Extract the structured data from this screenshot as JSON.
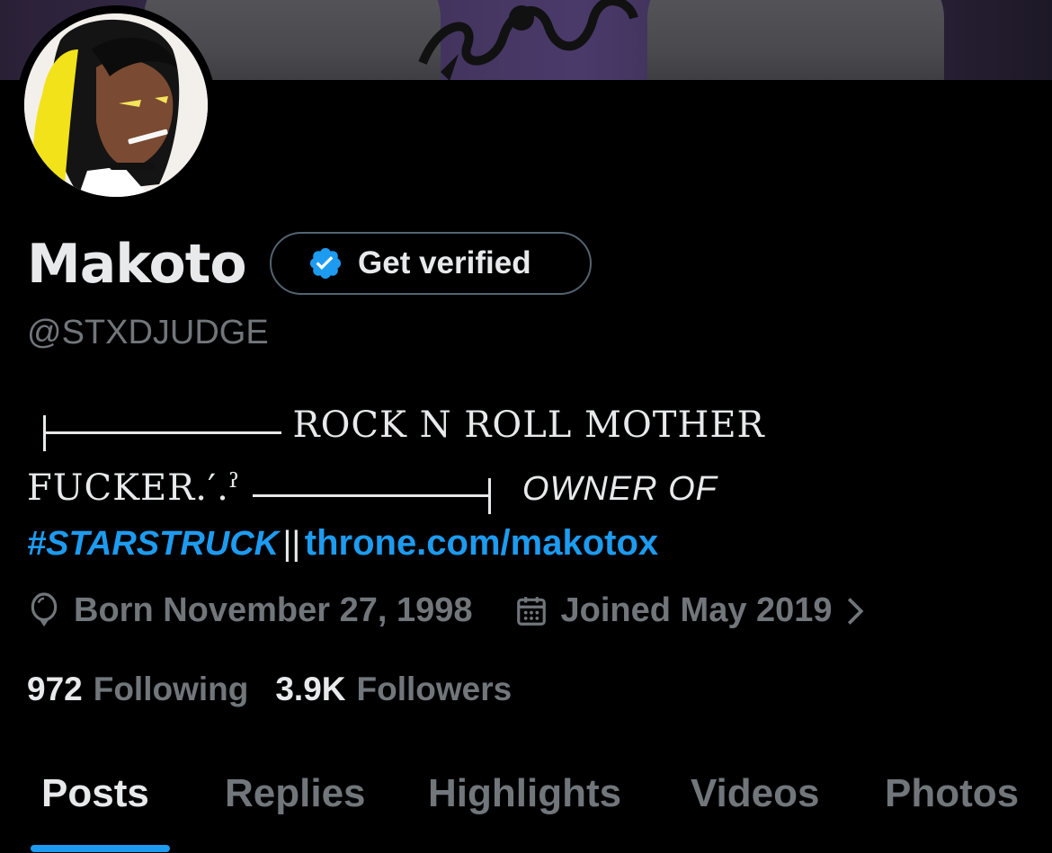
{
  "profile": {
    "display_name": "Makoto",
    "verify_label": "Get verified",
    "handle": "@STXDJUDGE"
  },
  "bio": {
    "line1_text": "ROCK N ROLL MOTHER",
    "line2_text": "FUCKER.′.ˀ",
    "line2_label": "OWNER OF",
    "hashtag": "#STARSTRUCK",
    "separator": "||",
    "link": "throne.com/makotox"
  },
  "meta": {
    "born": "Born November 27, 1998",
    "joined": "Joined May 2019",
    "born_icon": "balloon-icon",
    "joined_icon": "calendar-icon"
  },
  "counts": {
    "following_num": "972",
    "following_label": "Following",
    "followers_num": "3.9K",
    "followers_label": "Followers"
  },
  "tabs": [
    {
      "label": "Posts",
      "active": true
    },
    {
      "label": "Replies",
      "active": false
    },
    {
      "label": "Highlights",
      "active": false
    },
    {
      "label": "Videos",
      "active": false
    },
    {
      "label": "Photos",
      "active": false
    }
  ],
  "colors": {
    "accent": "#1d9bf0",
    "background": "#000000",
    "text_primary": "#e7e9ea",
    "text_secondary": "#71767b"
  }
}
